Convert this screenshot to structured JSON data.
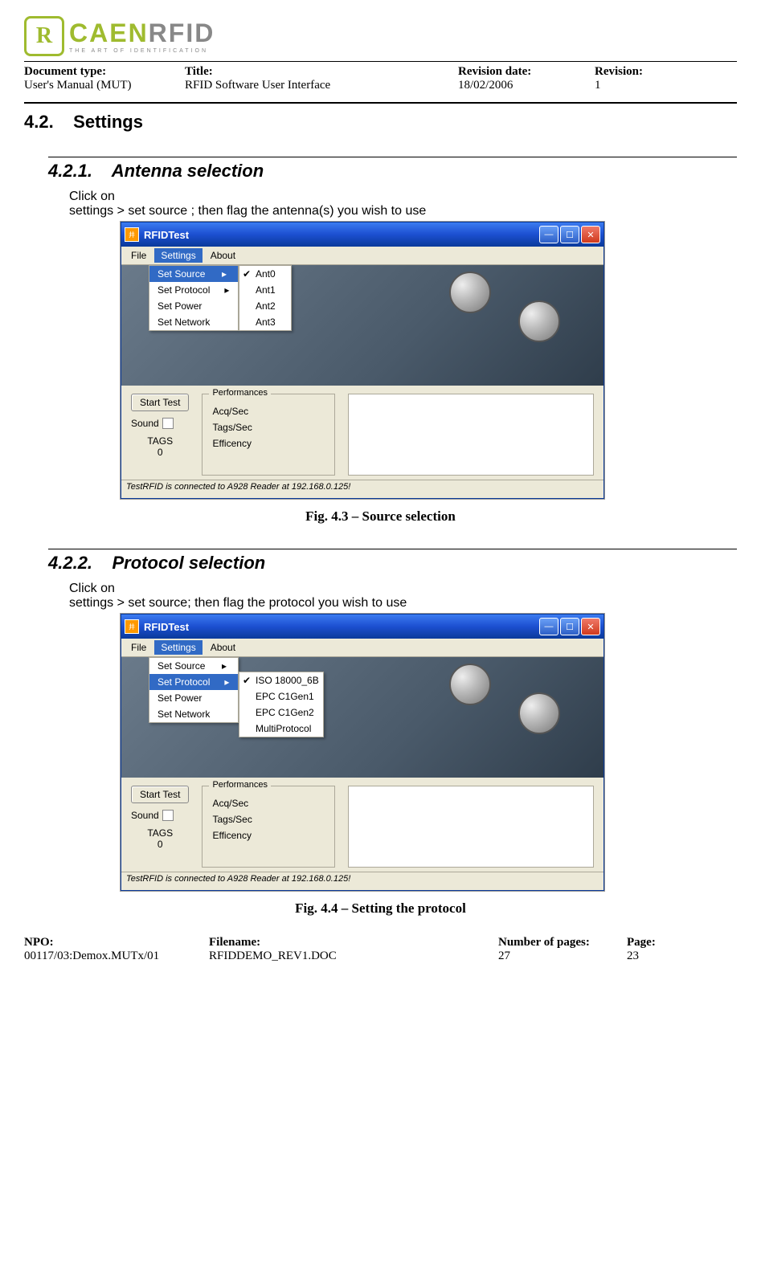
{
  "logo": {
    "mark": "R",
    "main1": "CAEN",
    "main2": "RFID",
    "tag": "THE ART OF IDENTIFICATION"
  },
  "header": {
    "docTypeLabel": "Document type:",
    "docType": "User's Manual (MUT)",
    "titleLabel": "Title:",
    "title": "RFID Software User Interface",
    "revDateLabel": "Revision date:",
    "revDate": "18/02/2006",
    "revLabel": "Revision:",
    "rev": "1"
  },
  "section": {
    "num": "4.2.",
    "title": "Settings"
  },
  "sub1": {
    "num": "4.2.1.",
    "title": "Antenna selection",
    "line1": "Click on",
    "line2": "settings > set source ; then flag the antenna(s) you wish to use",
    "caption": "Fig. 4.3 – Source selection"
  },
  "sub2": {
    "num": "4.2.2.",
    "title": "Protocol selection",
    "line1": "Click on",
    "line2": "settings > set source; then flag the protocol you wish to use",
    "caption": "Fig. 4.4 – Setting the protocol"
  },
  "win": {
    "title": "RFIDTest",
    "menu": {
      "file": "File",
      "settings": "Settings",
      "about": "About"
    },
    "settingsMenu": {
      "setSource": "Set Source",
      "setProtocol": "Set Protocol",
      "setPower": "Set Power",
      "setNetwork": "Set Network"
    },
    "antennas": {
      "a0": "Ant0",
      "a1": "Ant1",
      "a2": "Ant2",
      "a3": "Ant3"
    },
    "protocols": {
      "p0": "ISO 18000_6B",
      "p1": "EPC C1Gen1",
      "p2": "EPC C1Gen2",
      "p3": "MultiProtocol"
    },
    "startTest": "Start Test",
    "sound": "Sound",
    "tags": "TAGS",
    "tagsCount": "0",
    "perf": {
      "legend": "Performances",
      "acq": "Acq/Sec",
      "tagsSec": "Tags/Sec",
      "eff": "Efficency"
    },
    "status": "TestRFID is connected to A928 Reader at 192.168.0.125!"
  },
  "footer": {
    "npoLabel": "NPO:",
    "npo": "00117/03:Demox.MUTx/01",
    "filenameLabel": "Filename:",
    "filename": "RFIDDEMO_REV1.DOC",
    "pagesLabel": "Number of pages:",
    "pages": "27",
    "pageLabel": "Page:",
    "page": "23"
  }
}
